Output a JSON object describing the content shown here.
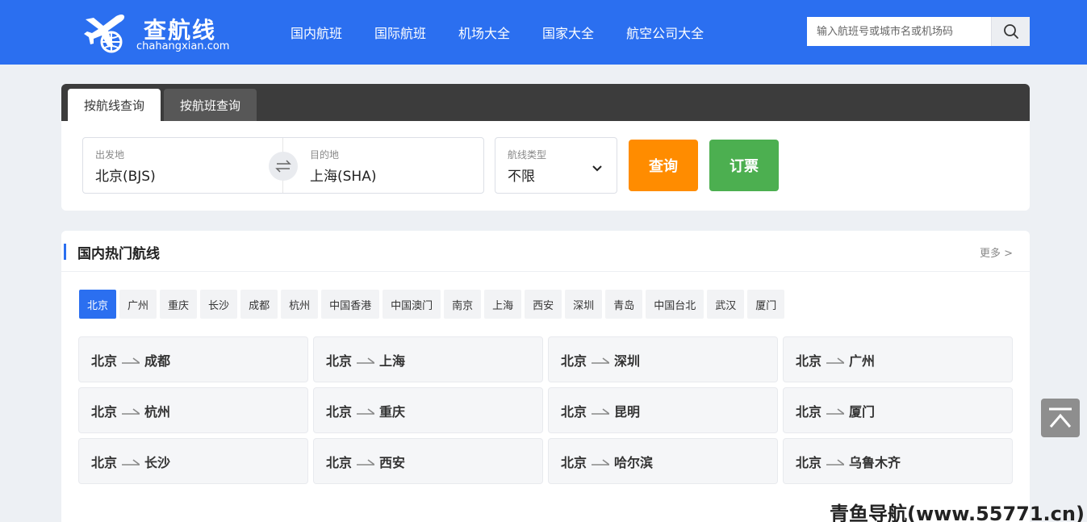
{
  "header": {
    "logo_title": "查航线",
    "logo_sub": "chahangxian.com",
    "nav": [
      "国内航班",
      "国际航班",
      "机场大全",
      "国家大全",
      "航空公司大全"
    ],
    "search_placeholder": "输入航班号或城市名或机场码"
  },
  "search_panel": {
    "tabs": [
      "按航线查询",
      "按航班查询"
    ],
    "from_label": "出发地",
    "from_value": "北京(BJS)",
    "to_label": "目的地",
    "to_value": "上海(SHA)",
    "type_label": "航线类型",
    "type_value": "不限",
    "query_button": "查询",
    "book_button": "订票"
  },
  "hot_routes": {
    "title": "国内热门航线",
    "more": "更多 >",
    "cities": [
      "北京",
      "广州",
      "重庆",
      "长沙",
      "成都",
      "杭州",
      "中国香港",
      "中国澳门",
      "南京",
      "上海",
      "西安",
      "深圳",
      "青岛",
      "中国台北",
      "武汉",
      "厦门"
    ],
    "active_city": "北京",
    "routes": [
      {
        "from": "北京",
        "to": "成都"
      },
      {
        "from": "北京",
        "to": "上海"
      },
      {
        "from": "北京",
        "to": "深圳"
      },
      {
        "from": "北京",
        "to": "广州"
      },
      {
        "from": "北京",
        "to": "杭州"
      },
      {
        "from": "北京",
        "to": "重庆"
      },
      {
        "from": "北京",
        "to": "昆明"
      },
      {
        "from": "北京",
        "to": "厦门"
      },
      {
        "from": "北京",
        "to": "长沙"
      },
      {
        "from": "北京",
        "to": "西安"
      },
      {
        "from": "北京",
        "to": "哈尔滨"
      },
      {
        "from": "北京",
        "to": "乌鲁木齐"
      }
    ]
  },
  "watermark": "青鱼导航(www.55771.cn)",
  "colors": {
    "brand_blue": "#2b6ff0",
    "query_orange": "#ff8c00",
    "book_green": "#4caf50"
  }
}
